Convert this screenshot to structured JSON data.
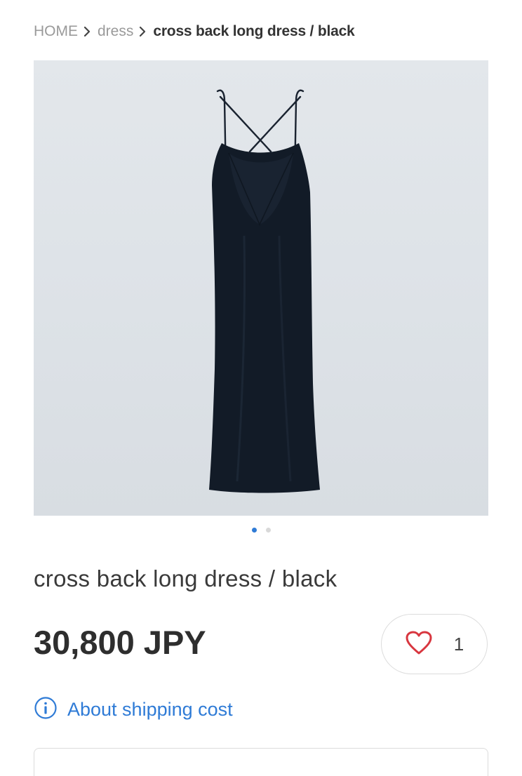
{
  "breadcrumb": {
    "home": "HOME",
    "category": "dress",
    "current": "cross back long dress / black"
  },
  "carousel": {
    "total_slides": 2,
    "active_slide": 1
  },
  "product": {
    "title": "cross back long dress / black",
    "price": "30,800 JPY",
    "like_count": "1"
  },
  "shipping": {
    "label": "About shipping cost"
  },
  "colors": {
    "accent": "#2f7bd6",
    "heart": "#d8363f",
    "text": "#333333"
  },
  "icons": {
    "breadcrumb_separator": "chevron-right-icon",
    "like": "heart-outline-icon",
    "info": "info-circle-icon"
  }
}
